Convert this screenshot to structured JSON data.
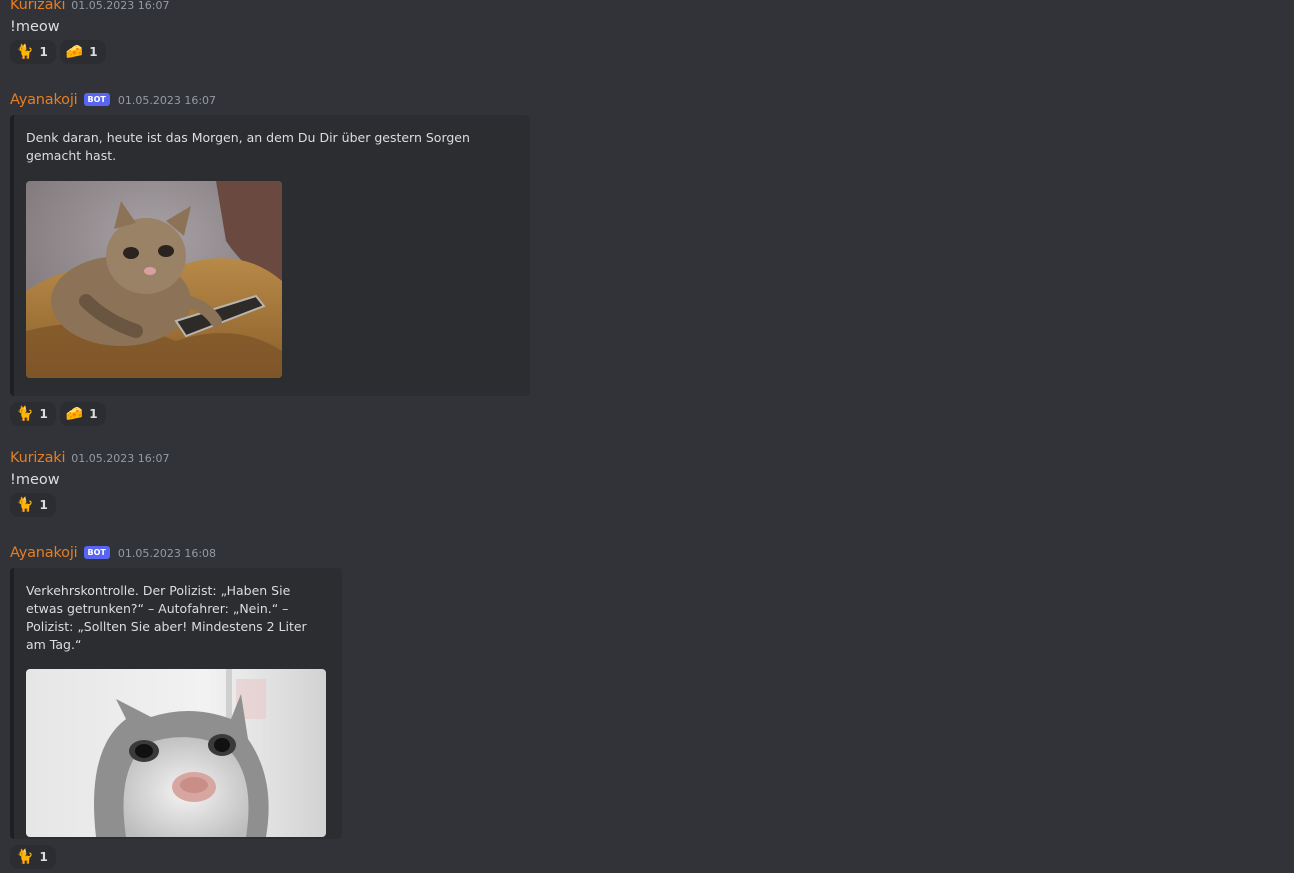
{
  "messages": [
    {
      "author": "Kurizaki",
      "timestamp": "01.05.2023 16:07",
      "text": "!meow",
      "reactions": [
        {
          "emoji": "🐈",
          "count": "1"
        },
        {
          "emoji": "🧀",
          "count": "1"
        }
      ]
    },
    {
      "author": "Ayanakoji",
      "bot_tag": "BOT",
      "timestamp": "01.05.2023 16:07",
      "embed": {
        "description": "Denk daran, heute ist das Morgen, an dem Du Dir über gestern Sorgen gemacht hast."
      },
      "reactions": [
        {
          "emoji": "🐈",
          "count": "1"
        },
        {
          "emoji": "🧀",
          "count": "1"
        }
      ]
    },
    {
      "author": "Kurizaki",
      "timestamp": "01.05.2023 16:07",
      "text": "!meow",
      "reactions": [
        {
          "emoji": "🐈",
          "count": "1"
        }
      ]
    },
    {
      "author": "Ayanakoji",
      "bot_tag": "BOT",
      "timestamp": "01.05.2023 16:08",
      "embed": {
        "description": "Verkehrskontrolle. Der Polizist: „Haben Sie etwas getrunken?“ – Autofahrer: „Nein.“ – Polizist: „Sollten Sie aber! Mindestens 2 Liter am Tag.“"
      },
      "reactions": [
        {
          "emoji": "🐈",
          "count": "1"
        }
      ]
    }
  ],
  "colors": {
    "background": "#313338",
    "username": "#e67e22",
    "bot_tag": "#5865f2",
    "embed_bg": "#2b2d31"
  }
}
